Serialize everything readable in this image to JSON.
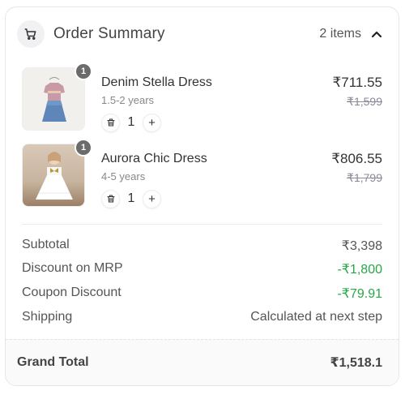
{
  "header": {
    "title": "Order Summary",
    "count": "2 items",
    "cart_icon": "cart-icon",
    "toggle_icon": "chevron-up-icon"
  },
  "items": [
    {
      "qty_badge": "1",
      "name": "Denim Stella Dress",
      "age": "1.5-2 years",
      "qty": "1",
      "price": "₹711.55",
      "mrp": "₹1,599"
    },
    {
      "qty_badge": "1",
      "name": "Aurora Chic Dress",
      "age": "4-5 years",
      "qty": "1",
      "price": "₹806.55",
      "mrp": "₹1,799"
    }
  ],
  "summary": {
    "subtotal_label": "Subtotal",
    "subtotal_value": "₹3,398",
    "discount_label": "Discount on MRP",
    "discount_value": "-₹1,800",
    "coupon_label": "Coupon Discount",
    "coupon_value": "-₹79.91",
    "shipping_label": "Shipping",
    "shipping_value": "Calculated at next step"
  },
  "total": {
    "label": "Grand Total",
    "value": "₹1,518.1"
  },
  "colors": {
    "discount": "#27a748",
    "badge": "#6b6b6b"
  }
}
